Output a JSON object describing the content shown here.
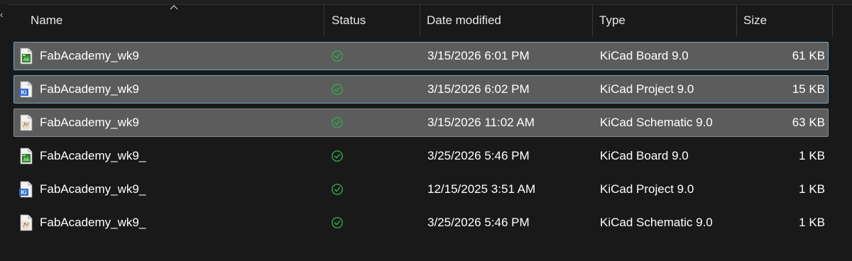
{
  "columns": {
    "name": "Name",
    "status": "Status",
    "date_modified": "Date modified",
    "type": "Type",
    "size": "Size"
  },
  "colors": {
    "selection_bg": "#5c5c5c",
    "focus_border": "#6fa4c9",
    "status_green": "#2fa84f"
  },
  "files": [
    {
      "name": "FabAcademy_wk9",
      "icon": "kicad-board-icon",
      "status": "synced",
      "date": "3/15/2026 6:01 PM",
      "type": "KiCad Board 9.0",
      "size": "61 KB",
      "selected": true
    },
    {
      "name": "FabAcademy_wk9",
      "icon": "kicad-project-icon",
      "status": "synced",
      "date": "3/15/2026 6:02 PM",
      "type": "KiCad Project 9.0",
      "size": "15 KB",
      "selected": true
    },
    {
      "name": "FabAcademy_wk9",
      "icon": "kicad-schematic-icon",
      "status": "synced",
      "date": "3/15/2026 11:02 AM",
      "type": "KiCad Schematic 9.0",
      "size": "63 KB",
      "selected": true
    },
    {
      "name": "FabAcademy_wk9_",
      "icon": "kicad-board-icon",
      "status": "synced",
      "date": "3/25/2026 5:46 PM",
      "type": "KiCad Board 9.0",
      "size": "1 KB",
      "selected": false
    },
    {
      "name": "FabAcademy_wk9_",
      "icon": "kicad-project-icon",
      "status": "synced",
      "date": "12/15/2025 3:51 AM",
      "type": "KiCad Project 9.0",
      "size": "1 KB",
      "selected": false
    },
    {
      "name": "FabAcademy_wk9_",
      "icon": "kicad-schematic-icon",
      "status": "synced",
      "date": "3/25/2026 5:46 PM",
      "type": "KiCad Schematic 9.0",
      "size": "1 KB",
      "selected": false
    }
  ]
}
